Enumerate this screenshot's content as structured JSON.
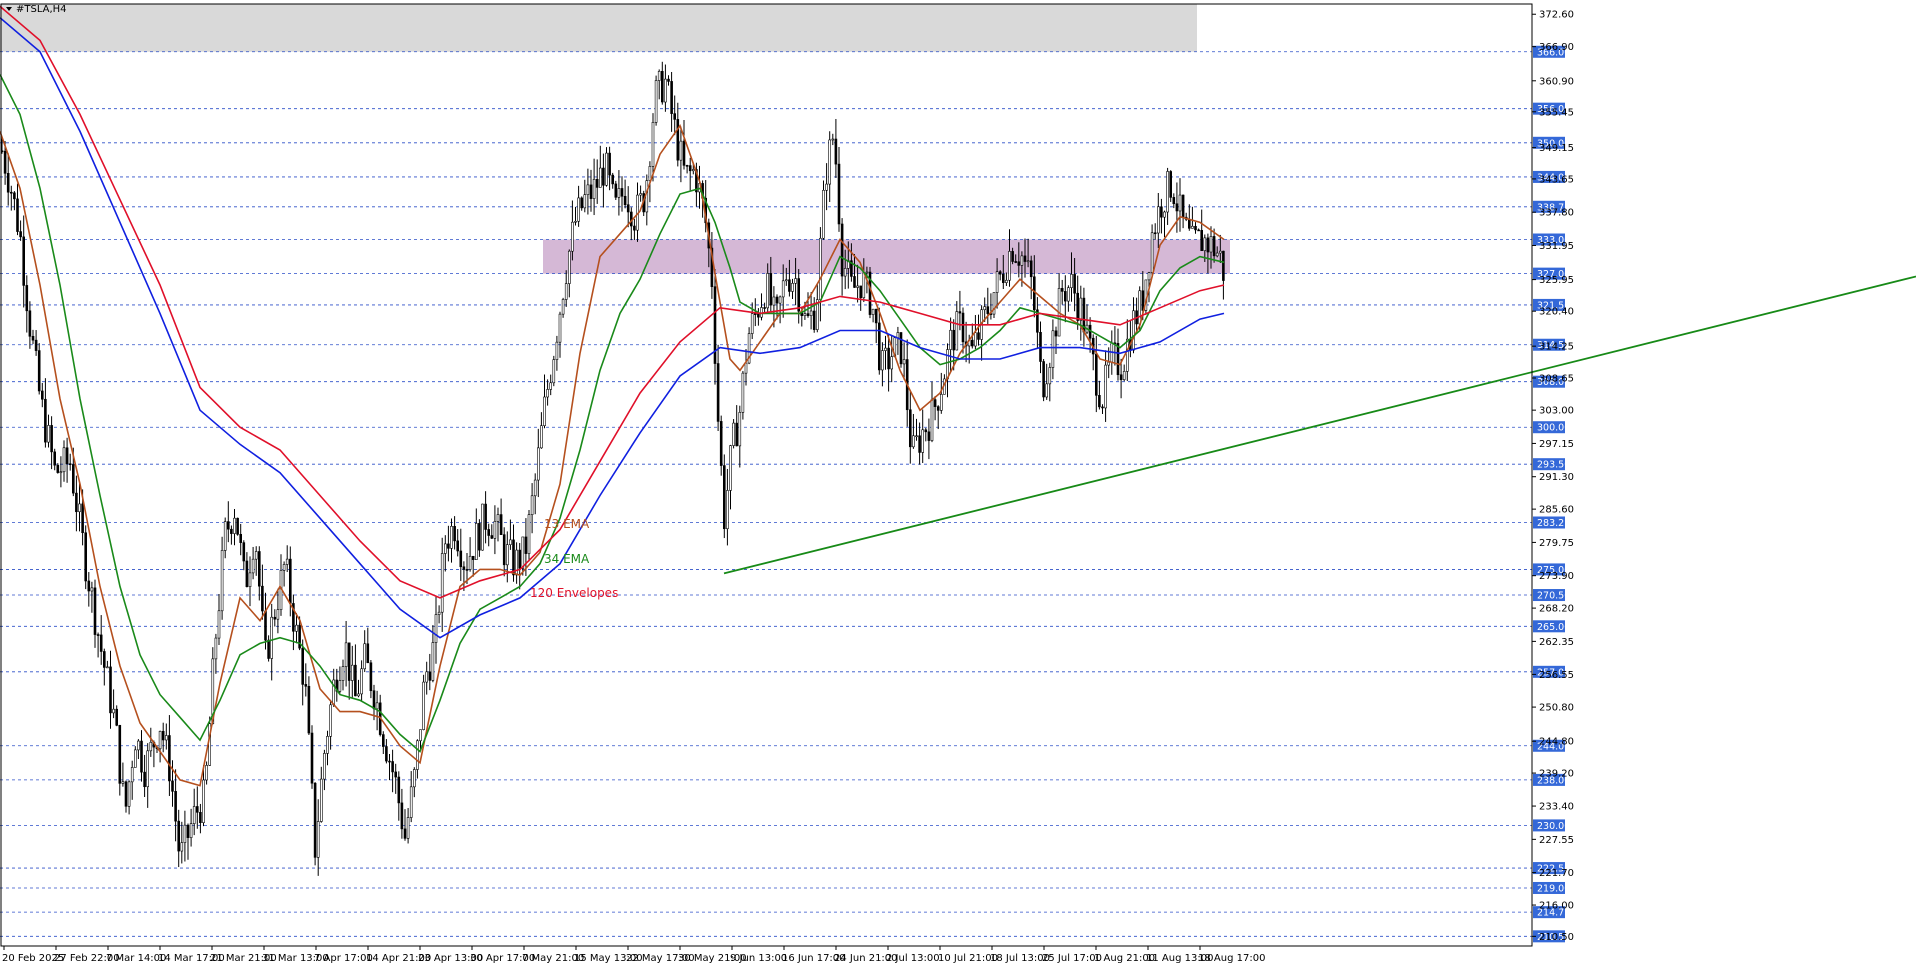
{
  "window": {
    "symbol_label": "#TSLA,H4"
  },
  "chart_data": {
    "type": "candlestick",
    "symbol": "#TSLA",
    "timeframe": "H4",
    "ylim": [
      208.8,
      374.4
    ],
    "y_ticks": [
      372.6,
      360.9,
      349.15,
      337.8,
      325.95,
      314.25,
      303.0,
      291.3,
      279.75,
      268.2,
      256.55,
      244.8,
      233.4,
      221.7,
      210.5,
      366.9,
      355.45,
      343.65,
      331.95,
      320.4,
      308.65,
      297.15,
      285.6,
      273.9,
      262.35,
      250.8,
      239.2,
      227.55,
      216.0
    ],
    "x_ticks": [
      "20 Feb 2025",
      "27 Feb 22:00",
      "7 Mar 14:00",
      "14 Mar 17:00",
      "21 Mar 21:00",
      "31 Mar 13:00",
      "7 Apr 17:00",
      "14 Apr 21:00",
      "23 Apr 13:00",
      "30 Apr 17:00",
      "7 May 21:00",
      "15 May 13:00",
      "22 May 17:00",
      "30 May 21:00",
      "9 Jun 13:00",
      "16 Jun 17:00",
      "24 Jun 21:00",
      "2 Jul 13:00",
      "10 Jul 21:00",
      "18 Jul 13:00",
      "25 Jul 17:00",
      "1 Aug 21:00",
      "11 Aug 13:00",
      "18 Aug 17:00"
    ],
    "levels": [
      366.0,
      356.0,
      350.0,
      344.0,
      338.75,
      333.0,
      327.0,
      321.5,
      314.5,
      308.0,
      300.0,
      293.5,
      283.25,
      275.0,
      270.5,
      265.0,
      257.0,
      244.0,
      238.0,
      230.0,
      222.5,
      219.0,
      214.75,
      210.5
    ],
    "zones": [
      {
        "from": 366.0,
        "to": 374.4,
        "color": "#d9d9d9"
      },
      {
        "from": 327.0,
        "to": 333.0,
        "color": "#d5b8d6"
      }
    ],
    "trendline": {
      "from": [
        724,
        274.3
      ],
      "to": [
        1916,
        326.5
      ],
      "color": "#178a17"
    },
    "candles_anchor": [
      [
        0,
        350
      ],
      [
        10,
        343
      ],
      [
        20,
        334
      ],
      [
        30,
        318
      ],
      [
        40,
        305
      ],
      [
        55,
        292
      ],
      [
        70,
        294
      ],
      [
        85,
        277
      ],
      [
        100,
        262
      ],
      [
        115,
        248
      ],
      [
        125,
        232
      ],
      [
        135,
        246
      ],
      [
        145,
        240
      ],
      [
        160,
        248
      ],
      [
        170,
        240
      ],
      [
        180,
        224
      ],
      [
        195,
        232
      ],
      [
        205,
        235
      ],
      [
        215,
        262
      ],
      [
        225,
        281
      ],
      [
        235,
        286
      ],
      [
        245,
        272
      ],
      [
        255,
        282
      ],
      [
        265,
        259
      ],
      [
        275,
        268
      ],
      [
        285,
        276
      ],
      [
        295,
        265
      ],
      [
        305,
        255
      ],
      [
        315,
        226
      ],
      [
        325,
        244
      ],
      [
        335,
        256
      ],
      [
        345,
        262
      ],
      [
        355,
        252
      ],
      [
        365,
        259
      ],
      [
        375,
        253
      ],
      [
        385,
        245
      ],
      [
        395,
        238
      ],
      [
        405,
        228
      ],
      [
        415,
        239
      ],
      [
        425,
        256
      ],
      [
        435,
        262
      ],
      [
        445,
        280
      ],
      [
        455,
        283
      ],
      [
        465,
        276
      ],
      [
        475,
        280
      ],
      [
        485,
        284
      ],
      [
        495,
        283
      ],
      [
        505,
        278
      ],
      [
        515,
        276
      ],
      [
        525,
        278
      ],
      [
        535,
        290
      ],
      [
        545,
        304
      ],
      [
        555,
        315
      ],
      [
        565,
        327
      ],
      [
        575,
        336
      ],
      [
        585,
        340
      ],
      [
        595,
        342
      ],
      [
        605,
        346
      ],
      [
        615,
        338
      ],
      [
        625,
        342
      ],
      [
        635,
        337
      ],
      [
        645,
        341
      ],
      [
        655,
        358
      ],
      [
        665,
        361
      ],
      [
        675,
        352
      ],
      [
        685,
        344
      ],
      [
        695,
        345
      ],
      [
        705,
        337
      ],
      [
        712,
        326
      ],
      [
        718,
        302
      ],
      [
        724,
        284
      ],
      [
        732,
        296
      ],
      [
        740,
        303
      ],
      [
        748,
        316
      ],
      [
        756,
        320
      ],
      [
        766,
        325
      ],
      [
        776,
        318
      ],
      [
        786,
        327
      ],
      [
        796,
        326
      ],
      [
        806,
        318
      ],
      [
        816,
        321
      ],
      [
        826,
        345
      ],
      [
        834,
        352
      ],
      [
        842,
        330
      ],
      [
        852,
        324
      ],
      [
        862,
        326
      ],
      [
        872,
        322
      ],
      [
        882,
        310
      ],
      [
        892,
        313
      ],
      [
        902,
        314
      ],
      [
        912,
        295
      ],
      [
        922,
        299
      ],
      [
        932,
        302
      ],
      [
        942,
        308
      ],
      [
        952,
        316
      ],
      [
        962,
        318
      ],
      [
        972,
        313
      ],
      [
        982,
        318
      ],
      [
        992,
        323
      ],
      [
        1002,
        327
      ],
      [
        1012,
        332
      ],
      [
        1022,
        330
      ],
      [
        1032,
        325
      ],
      [
        1042,
        307
      ],
      [
        1052,
        315
      ],
      [
        1062,
        324
      ],
      [
        1072,
        325
      ],
      [
        1082,
        320
      ],
      [
        1092,
        312
      ],
      [
        1102,
        305
      ],
      [
        1112,
        312
      ],
      [
        1122,
        311
      ],
      [
        1132,
        318
      ],
      [
        1142,
        322
      ],
      [
        1152,
        334
      ],
      [
        1162,
        340
      ],
      [
        1172,
        343
      ],
      [
        1182,
        336
      ],
      [
        1192,
        332
      ],
      [
        1202,
        333
      ],
      [
        1212,
        332
      ],
      [
        1220,
        330
      ],
      [
        1224,
        327
      ]
    ],
    "series": [
      {
        "name": "13 EMA",
        "color": "#b5501e",
        "values": [
          [
            0,
            352
          ],
          [
            20,
            342
          ],
          [
            40,
            325
          ],
          [
            60,
            305
          ],
          [
            80,
            290
          ],
          [
            100,
            272
          ],
          [
            120,
            258
          ],
          [
            140,
            248
          ],
          [
            160,
            243
          ],
          [
            180,
            238
          ],
          [
            200,
            237
          ],
          [
            220,
            255
          ],
          [
            240,
            270
          ],
          [
            260,
            266
          ],
          [
            280,
            272
          ],
          [
            300,
            266
          ],
          [
            320,
            254
          ],
          [
            340,
            250
          ],
          [
            360,
            250
          ],
          [
            380,
            249
          ],
          [
            400,
            244
          ],
          [
            420,
            241
          ],
          [
            440,
            258
          ],
          [
            460,
            272
          ],
          [
            480,
            275
          ],
          [
            500,
            275
          ],
          [
            520,
            274
          ],
          [
            540,
            278
          ],
          [
            560,
            290
          ],
          [
            580,
            313
          ],
          [
            600,
            330
          ],
          [
            620,
            334
          ],
          [
            640,
            338
          ],
          [
            660,
            348
          ],
          [
            680,
            353
          ],
          [
            700,
            343
          ],
          [
            715,
            327
          ],
          [
            730,
            312
          ],
          [
            740,
            310
          ],
          [
            760,
            315
          ],
          [
            780,
            320
          ],
          [
            800,
            320
          ],
          [
            820,
            326
          ],
          [
            840,
            333
          ],
          [
            860,
            329
          ],
          [
            880,
            320
          ],
          [
            900,
            310
          ],
          [
            920,
            303
          ],
          [
            940,
            306
          ],
          [
            960,
            313
          ],
          [
            980,
            318
          ],
          [
            1000,
            322
          ],
          [
            1020,
            326
          ],
          [
            1040,
            323
          ],
          [
            1060,
            320
          ],
          [
            1080,
            318
          ],
          [
            1100,
            312
          ],
          [
            1120,
            311
          ],
          [
            1140,
            318
          ],
          [
            1160,
            332
          ],
          [
            1180,
            337
          ],
          [
            1200,
            336
          ],
          [
            1224,
            333
          ]
        ]
      },
      {
        "name": "34 EMA",
        "color": "#1a8a1a",
        "values": [
          [
            0,
            362
          ],
          [
            20,
            355
          ],
          [
            40,
            342
          ],
          [
            60,
            325
          ],
          [
            80,
            305
          ],
          [
            100,
            288
          ],
          [
            120,
            272
          ],
          [
            140,
            260
          ],
          [
            160,
            253
          ],
          [
            180,
            249
          ],
          [
            200,
            245
          ],
          [
            220,
            252
          ],
          [
            240,
            260
          ],
          [
            260,
            262
          ],
          [
            280,
            263
          ],
          [
            300,
            262
          ],
          [
            320,
            258
          ],
          [
            340,
            253
          ],
          [
            360,
            252
          ],
          [
            380,
            250
          ],
          [
            400,
            246
          ],
          [
            420,
            243
          ],
          [
            440,
            252
          ],
          [
            460,
            262
          ],
          [
            480,
            268
          ],
          [
            500,
            270
          ],
          [
            520,
            272
          ],
          [
            540,
            276
          ],
          [
            560,
            284
          ],
          [
            580,
            296
          ],
          [
            600,
            310
          ],
          [
            620,
            320
          ],
          [
            640,
            326
          ],
          [
            660,
            334
          ],
          [
            680,
            341
          ],
          [
            700,
            342
          ],
          [
            715,
            336
          ],
          [
            730,
            328
          ],
          [
            740,
            322
          ],
          [
            760,
            320
          ],
          [
            780,
            320
          ],
          [
            800,
            320
          ],
          [
            820,
            322
          ],
          [
            840,
            330
          ],
          [
            860,
            328
          ],
          [
            880,
            324
          ],
          [
            900,
            319
          ],
          [
            920,
            314
          ],
          [
            940,
            311
          ],
          [
            960,
            312
          ],
          [
            980,
            314
          ],
          [
            1000,
            317
          ],
          [
            1020,
            321
          ],
          [
            1040,
            320
          ],
          [
            1060,
            319
          ],
          [
            1080,
            318
          ],
          [
            1100,
            316
          ],
          [
            1120,
            314
          ],
          [
            1140,
            317
          ],
          [
            1160,
            324
          ],
          [
            1180,
            328
          ],
          [
            1200,
            330
          ],
          [
            1224,
            329
          ]
        ]
      },
      {
        "name": "120 Envelopes",
        "color": "#e0102a",
        "values": [
          [
            0,
            374
          ],
          [
            40,
            368
          ],
          [
            80,
            355
          ],
          [
            120,
            340
          ],
          [
            160,
            325
          ],
          [
            200,
            307
          ],
          [
            240,
            300
          ],
          [
            280,
            296
          ],
          [
            320,
            288
          ],
          [
            360,
            280
          ],
          [
            400,
            273
          ],
          [
            440,
            270
          ],
          [
            480,
            273
          ],
          [
            520,
            275
          ],
          [
            560,
            282
          ],
          [
            600,
            294
          ],
          [
            640,
            306
          ],
          [
            680,
            315
          ],
          [
            720,
            321
          ],
          [
            760,
            320
          ],
          [
            800,
            321
          ],
          [
            840,
            323
          ],
          [
            880,
            322
          ],
          [
            920,
            320
          ],
          [
            960,
            318
          ],
          [
            1000,
            318
          ],
          [
            1040,
            320
          ],
          [
            1080,
            319
          ],
          [
            1120,
            318
          ],
          [
            1160,
            321
          ],
          [
            1200,
            324
          ],
          [
            1224,
            325
          ]
        ]
      },
      {
        "name": "",
        "color": "#1020e0",
        "values": [
          [
            0,
            372
          ],
          [
            40,
            366
          ],
          [
            80,
            352
          ],
          [
            120,
            336
          ],
          [
            160,
            320
          ],
          [
            200,
            303
          ],
          [
            240,
            297
          ],
          [
            280,
            292
          ],
          [
            320,
            284
          ],
          [
            360,
            276
          ],
          [
            400,
            268
          ],
          [
            440,
            263
          ],
          [
            480,
            267
          ],
          [
            520,
            270
          ],
          [
            560,
            276
          ],
          [
            600,
            288
          ],
          [
            640,
            299
          ],
          [
            680,
            309
          ],
          [
            720,
            314
          ],
          [
            760,
            313
          ],
          [
            800,
            314
          ],
          [
            840,
            317
          ],
          [
            880,
            317
          ],
          [
            920,
            314
          ],
          [
            960,
            312
          ],
          [
            1000,
            312
          ],
          [
            1040,
            314
          ],
          [
            1080,
            314
          ],
          [
            1120,
            313
          ],
          [
            1160,
            315
          ],
          [
            1200,
            319
          ],
          [
            1224,
            320
          ]
        ]
      }
    ],
    "annotations": [
      {
        "text": "13 EMA",
        "color": "#b5501e"
      },
      {
        "text": "34 EMA",
        "color": "#1a8a1a"
      },
      {
        "text": "120 Envelopes",
        "color": "#e0102a"
      }
    ],
    "grid": "levels-dashed",
    "legend": "none"
  }
}
